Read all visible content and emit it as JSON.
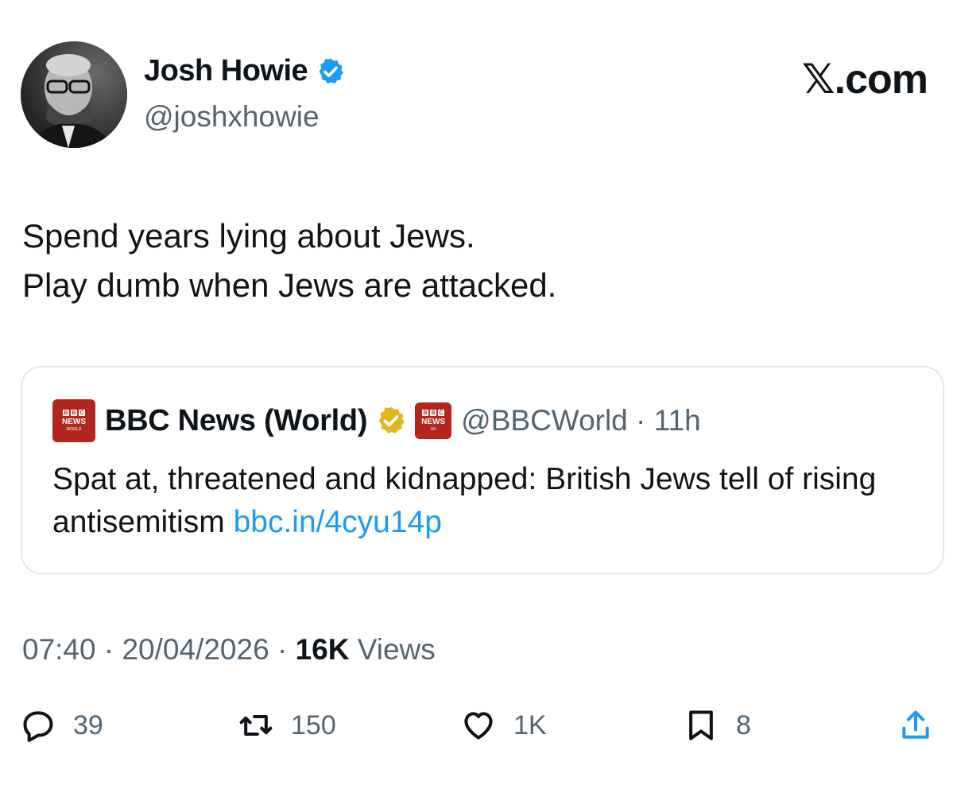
{
  "author": {
    "name": "Josh Howie",
    "handle": "@joshxhowie",
    "verified_icon": "blue-check-icon"
  },
  "brand": "𝕏.com",
  "tweet": {
    "lines": [
      "Spend years lying about Jews.",
      "Play dumb when Jews are attacked."
    ]
  },
  "quote": {
    "name": "BBC News (World)",
    "handle": "@BBCWorld",
    "separator": "·",
    "time": "11h",
    "text": "Spat at, threatened and kidnapped: British Jews tell of rising antisemitism",
    "link": "bbc.in/4cyu14p",
    "logo_text": "NEWS",
    "logo_sub": "WORLD",
    "affiliate_logo_sub": "UK"
  },
  "meta": {
    "time": "07:40",
    "date": "20/04/2026",
    "sep": "·",
    "views_count": "16K",
    "views_label": "Views"
  },
  "actions": {
    "replies": "39",
    "reposts": "150",
    "likes": "1K",
    "bookmarks": "8"
  },
  "colors": {
    "text": "#0f1419",
    "secondary": "#536471",
    "link": "#1d9bf0",
    "verified_blue": "#1d9bf0",
    "gold_badge": "#e2b719",
    "bbc_red": "#b3261e"
  }
}
